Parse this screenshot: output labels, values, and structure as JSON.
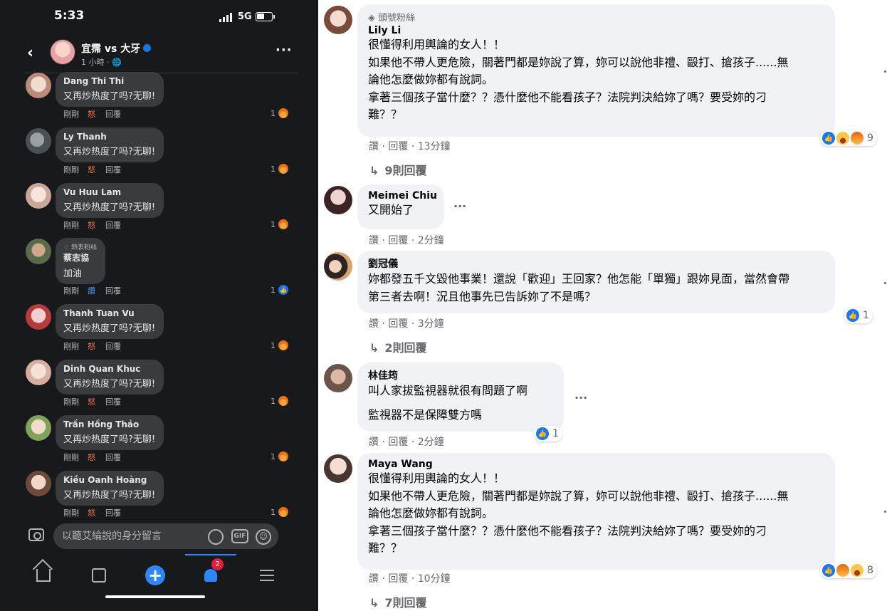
{
  "phone": {
    "status": {
      "time": "5:33",
      "network": "5G"
    },
    "post": {
      "title": "宜霈 vs 大牙",
      "subtitle": "1 小時 · "
    },
    "comments": [
      {
        "name": "Dang Thi Thi",
        "text": "又再炒热度了吗?无聊!",
        "time": "剛剛",
        "reaction": "怒",
        "reply": "回覆",
        "count": "1",
        "reaction_type": "angry"
      },
      {
        "name": "Ly Thanh",
        "text": "又再炒热度了吗?无聊!",
        "time": "剛剛",
        "reaction": "怒",
        "reply": "回覆",
        "count": "1",
        "reaction_type": "angry"
      },
      {
        "name": "Vu Huu Lam",
        "text": "又再炒热度了吗?无聊!",
        "time": "剛剛",
        "reaction": "怒",
        "reply": "回覆",
        "count": "1",
        "reaction_type": "angry"
      },
      {
        "badge": "熱衷粉絲",
        "name": "蔡志協",
        "text": "加油",
        "time": "剛剛",
        "reaction": "讚",
        "reply": "回覆",
        "count": "1",
        "reaction_type": "like"
      },
      {
        "name": "Thanh Tuan Vu",
        "text": "又再炒热度了吗?无聊!",
        "time": "剛剛",
        "reaction": "怒",
        "reply": "回覆",
        "count": "1",
        "reaction_type": "angry"
      },
      {
        "name": "Dinh Quan Khuc",
        "text": "又再炒热度了吗?无聊!",
        "time": "剛剛",
        "reaction": "怒",
        "reply": "回覆",
        "count": "1",
        "reaction_type": "angry"
      },
      {
        "name": "Trần Hồng Thảo",
        "text": "又再炒热度了吗?无聊!",
        "time": "剛剛",
        "reaction": "怒",
        "reply": "回覆",
        "count": "1",
        "reaction_type": "angry"
      },
      {
        "name": "Kiều Oanh Hoàng",
        "text": "又再炒热度了吗?无聊!",
        "time": "剛剛",
        "reaction": "怒",
        "reply": "回覆",
        "count": "1",
        "reaction_type": "angry"
      }
    ],
    "composer": {
      "placeholder": "以聽艾綸說的身分留言",
      "gif_label": "GIF"
    },
    "tabbar": {
      "notification_count": "2"
    }
  },
  "desktop": {
    "comments": [
      {
        "badge": "頭號粉絲",
        "name": "Lily Li",
        "lines": [
          "很懂得利用輿論的女人！！",
          "如果他不帶人更危險，關著門都是妳說了算，妳可以說他非禮、毆打、搶孩子......無",
          "論他怎麼做妳都有說詞。",
          "拿著三個孩子當什麼？？憑什麼他不能看孩子？法院判決給妳了嗎？要受妳的刁",
          "難？？"
        ],
        "meta": "讚 · 回覆 · 13分鐘",
        "reaction_count": "9",
        "replies": "9則回覆"
      },
      {
        "name": "Meimei Chiu",
        "lines": [
          "又開始了"
        ],
        "meta": "讚 · 回覆 · 2分鐘"
      },
      {
        "name": "劉冠儀",
        "lines": [
          "妳都發五千文毀他事業！還說「歡迎」王回家？他怎能「單獨」跟妳見面，當然會帶",
          "第三者去啊！況且他事先已告訴妳了不是嗎？"
        ],
        "meta": "讚 · 回覆 · 3分鐘",
        "reaction_count": "1",
        "replies": "2則回覆"
      },
      {
        "name": "林佳筠",
        "lines": [
          "叫人家拔監視器就很有問題了啊",
          "監視器不是保障雙方嗎"
        ],
        "meta": "讚 · 回覆 · 2分鐘",
        "reaction_count": "1"
      },
      {
        "name": "Maya Wang",
        "lines": [
          "很懂得利用輿論的女人！！",
          "如果他不帶人更危險，關著門都是妳說了算，妳可以說他非禮、毆打、搶孩子......無",
          "論他怎麼做妳都有說詞。",
          "拿著三個孩子當什麼？？憑什麼他不能看孩子？法院判決給妳了嗎？要受妳的刁",
          "難？？"
        ],
        "meta": "讚 · 回覆 · 10分鐘",
        "reaction_count": "8",
        "replies": "7則回覆"
      }
    ]
  },
  "colors": {
    "dark_bg": "#18191a",
    "dark_bubble": "#3a3b3c",
    "light_bubble": "#f0f2f5",
    "accent": "#1877f2",
    "angry": "#f7714c"
  }
}
